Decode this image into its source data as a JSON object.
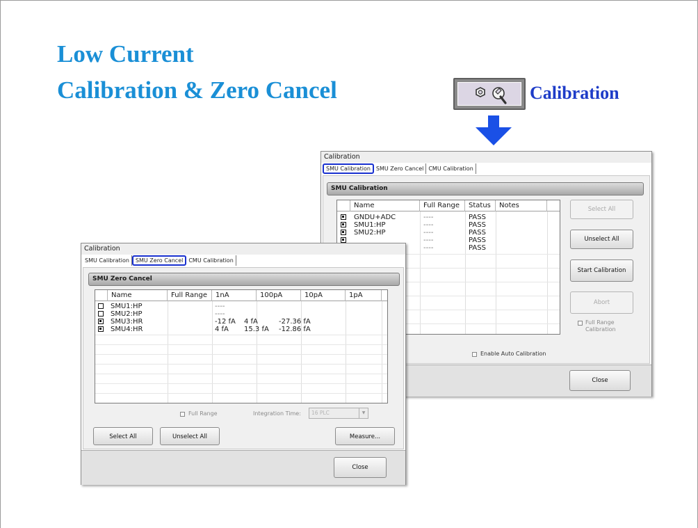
{
  "slide": {
    "title_line1": "Low Current",
    "title_line2": "Calibration & Zero Cancel",
    "calibration_button_label": "Calibration"
  },
  "dialog_calibration": {
    "window_title": "Calibration",
    "tabs": [
      "SMU Calibration",
      "SMU Zero Cancel",
      "CMU Calibration"
    ],
    "active_tab": "SMU Calibration",
    "section_title": "SMU Calibration",
    "columns": [
      "Name",
      "Full Range",
      "Status",
      "Notes"
    ],
    "rows": [
      {
        "checked": true,
        "name": "GNDU+ADC",
        "full_range": "----",
        "status": "PASS",
        "notes": ""
      },
      {
        "checked": true,
        "name": "SMU1:HP",
        "full_range": "----",
        "status": "PASS",
        "notes": ""
      },
      {
        "checked": true,
        "name": "SMU2:HP",
        "full_range": "----",
        "status": "PASS",
        "notes": ""
      },
      {
        "checked": true,
        "name": "",
        "full_range": "----",
        "status": "PASS",
        "notes": ""
      },
      {
        "checked": true,
        "name": "",
        "full_range": "----",
        "status": "PASS",
        "notes": ""
      }
    ],
    "buttons": {
      "select_all": "Select All",
      "unselect_all": "Unselect All",
      "start_calibration": "Start Calibration",
      "abort": "Abort",
      "close": "Close"
    },
    "full_range_calibration_line1": "Full Range",
    "full_range_calibration_line2": "Calibration",
    "enable_auto_calibration": "Enable Auto Calibration"
  },
  "dialog_zero_cancel": {
    "window_title": "Calibration",
    "tabs": [
      "SMU Calibration",
      "SMU Zero Cancel",
      "CMU Calibration"
    ],
    "active_tab": "SMU Zero Cancel",
    "section_title": "SMU Zero Cancel",
    "columns": [
      "Name",
      "Full Range",
      "1nA",
      "100pA",
      "10pA",
      "1pA"
    ],
    "rows": [
      {
        "checked": false,
        "name": "SMU1:HP",
        "full_range": "",
        "r1nA": "----",
        "r100pA": "",
        "r10pA": "",
        "r1pA": ""
      },
      {
        "checked": false,
        "name": "SMU2:HP",
        "full_range": "",
        "r1nA": "----",
        "r100pA": "",
        "r10pA": "",
        "r1pA": ""
      },
      {
        "checked": true,
        "name": "SMU3:HR",
        "full_range": "",
        "r1nA": "-12 fA",
        "r100pA": "4 fA",
        "r10pA": "-27.36 fA",
        "r1pA": ""
      },
      {
        "checked": true,
        "name": "SMU4:HR",
        "full_range": "",
        "r1nA": "4 fA",
        "r100pA": "15.3 fA",
        "r10pA": "-12.86 fA",
        "r1pA": ""
      }
    ],
    "full_range_label": "Full Range",
    "integration_time_label": "Integration Time:",
    "integration_time_value": "16 PLC",
    "buttons": {
      "select_all": "Select All",
      "unselect_all": "Unselect All",
      "measure": "Measure...",
      "close": "Close"
    }
  },
  "colors": {
    "title_blue": "#1a8fd6",
    "highlight_blue": "#1830d0",
    "arrow_blue": "#1a50e6"
  }
}
